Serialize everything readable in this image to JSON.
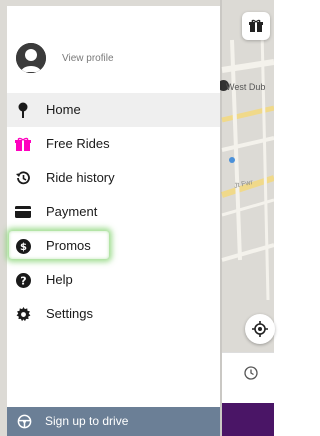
{
  "map": {
    "street_label": "West Dub",
    "avenue_label": "Jt Fwr"
  },
  "profile": {
    "view_profile_label": "View profile"
  },
  "menu": {
    "items": [
      {
        "label": "Home",
        "icon": "location-pin-icon",
        "active": true
      },
      {
        "label": "Free Rides",
        "icon": "gift-icon"
      },
      {
        "label": "Ride history",
        "icon": "history-icon"
      },
      {
        "label": "Payment",
        "icon": "credit-card-icon"
      },
      {
        "label": "Promos",
        "icon": "dollar-badge-icon",
        "highlighted": true
      },
      {
        "label": "Help",
        "icon": "question-mark-icon"
      },
      {
        "label": "Settings",
        "icon": "gear-icon"
      }
    ]
  },
  "footer": {
    "signup_label": "Sign up to drive",
    "signup_icon": "steering-wheel-icon"
  },
  "colors": {
    "free_rides_icon": "#ff00bf",
    "highlight": "#82d26e",
    "footer_bg": "#6b7f96",
    "purple_strip": "#4a1566"
  }
}
